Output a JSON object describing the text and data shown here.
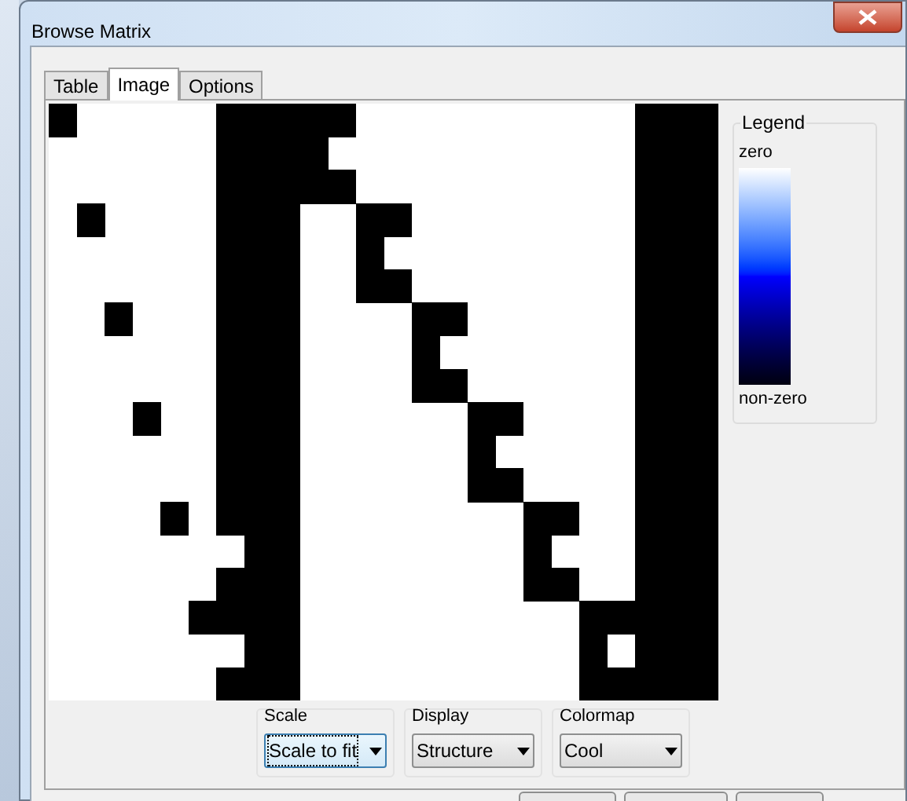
{
  "window": {
    "title": "Browse Matrix"
  },
  "tabs": [
    {
      "label": "Table",
      "selected": false
    },
    {
      "label": "Image",
      "selected": true
    },
    {
      "label": "Options",
      "selected": false
    }
  ],
  "legend": {
    "title": "Legend",
    "top_label": "zero",
    "bottom_label": "non-zero"
  },
  "controls": [
    {
      "label": "Scale",
      "value": "Scale to fit",
      "focused": true
    },
    {
      "label": "Display",
      "value": "Structure",
      "focused": false
    },
    {
      "label": "Colormap",
      "value": "Cool",
      "focused": false
    }
  ]
}
